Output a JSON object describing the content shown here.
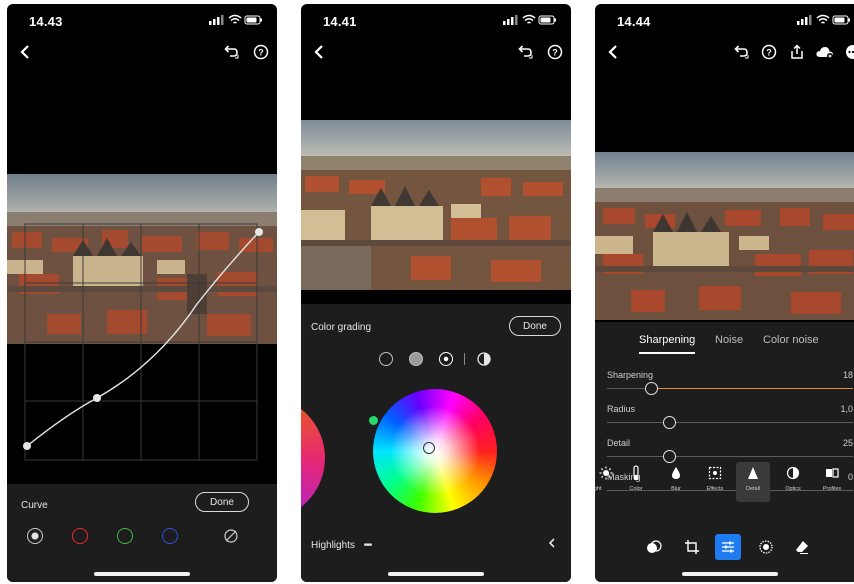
{
  "phones": [
    {
      "time": "14.43",
      "panel_title": "Curve",
      "done_label": "Done",
      "channels": [
        "white",
        "red",
        "green",
        "blue",
        "clear"
      ]
    },
    {
      "time": "14.41",
      "panel_title": "Color grading",
      "done_label": "Done",
      "region_label": "Highlights",
      "more_label": "•••"
    },
    {
      "time": "14.44",
      "subtabs": [
        "Sharpening",
        "Noise",
        "Color noise"
      ],
      "active_subtab": "Sharpening",
      "sliders": [
        {
          "label": "Sharpening",
          "value": "18",
          "fraction": 0.18
        },
        {
          "label": "Radius",
          "value": "1,0",
          "fraction": 0.25
        },
        {
          "label": "Detail",
          "value": "25",
          "fraction": 0.25
        },
        {
          "label": "Masking",
          "value": "0",
          "fraction": 0.0
        }
      ],
      "tools": [
        {
          "label": "Light",
          "display": "ight",
          "icon": "sun-icon"
        },
        {
          "label": "Color",
          "display": "Color",
          "icon": "thermometer-icon"
        },
        {
          "label": "Blur",
          "display": "Blur",
          "icon": "drop-icon"
        },
        {
          "label": "Effects",
          "display": "Effects",
          "icon": "effects-icon"
        },
        {
          "label": "Detail",
          "display": "Detail",
          "icon": "triangle-icon"
        },
        {
          "label": "Optics",
          "display": "Optics",
          "icon": "lens-icon"
        },
        {
          "label": "Profiles",
          "display": "Profiles",
          "icon": "profiles-icon"
        }
      ],
      "active_tool": "Detail"
    }
  ],
  "colors": {
    "accent_blue": "#1e7bf0",
    "slider_fill": "#e08a3c",
    "panel_bg": "#1d1d1d"
  }
}
